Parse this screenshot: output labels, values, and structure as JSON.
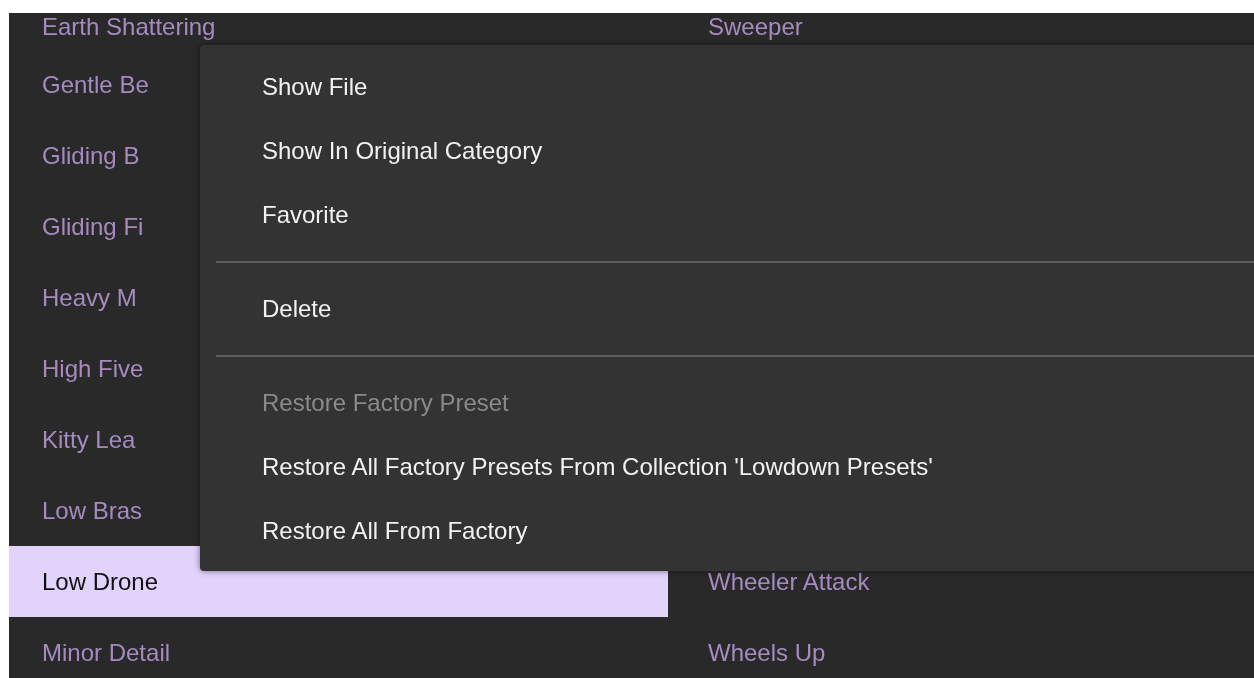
{
  "preset_list": {
    "rows": [
      {
        "column_1": {
          "label": "Earth Shattering",
          "selected": false
        },
        "column_2": {
          "label": "Sweeper",
          "selected": false
        }
      },
      {
        "column_1": {
          "label": "Gentle Be",
          "selected": false
        }
      },
      {
        "column_1": {
          "label": "Gliding B",
          "selected": false
        }
      },
      {
        "column_1": {
          "label": "Gliding Fi",
          "selected": false
        }
      },
      {
        "column_1": {
          "label": "Heavy M",
          "selected": false
        }
      },
      {
        "column_1": {
          "label": "High Five",
          "selected": false
        }
      },
      {
        "column_1": {
          "label": "Kitty Lea",
          "selected": false
        }
      },
      {
        "column_1": {
          "label": "Low Bras",
          "selected": false
        }
      },
      {
        "column_1": {
          "label": "Low Drone",
          "selected": true
        },
        "column_2": {
          "label": "Wheeler Attack",
          "selected": false
        }
      },
      {
        "column_1": {
          "label": "Minor Detail",
          "selected": false
        },
        "column_2": {
          "label": "Wheels Up",
          "selected": false
        }
      }
    ]
  },
  "context_menu": {
    "items": [
      {
        "kind": "item",
        "label": "Show File",
        "disabled": false
      },
      {
        "kind": "item",
        "label": "Show In Original Category",
        "disabled": false
      },
      {
        "kind": "item",
        "label": "Favorite",
        "disabled": false
      },
      {
        "kind": "separator"
      },
      {
        "kind": "item",
        "label": "Delete",
        "disabled": false
      },
      {
        "kind": "separator"
      },
      {
        "kind": "item",
        "label": "Restore Factory Preset",
        "disabled": true
      },
      {
        "kind": "item",
        "label": "Restore All Factory Presets From Collection 'Lowdown Presets'",
        "disabled": false
      },
      {
        "kind": "item",
        "label": "Restore All From Factory",
        "disabled": false
      }
    ]
  }
}
